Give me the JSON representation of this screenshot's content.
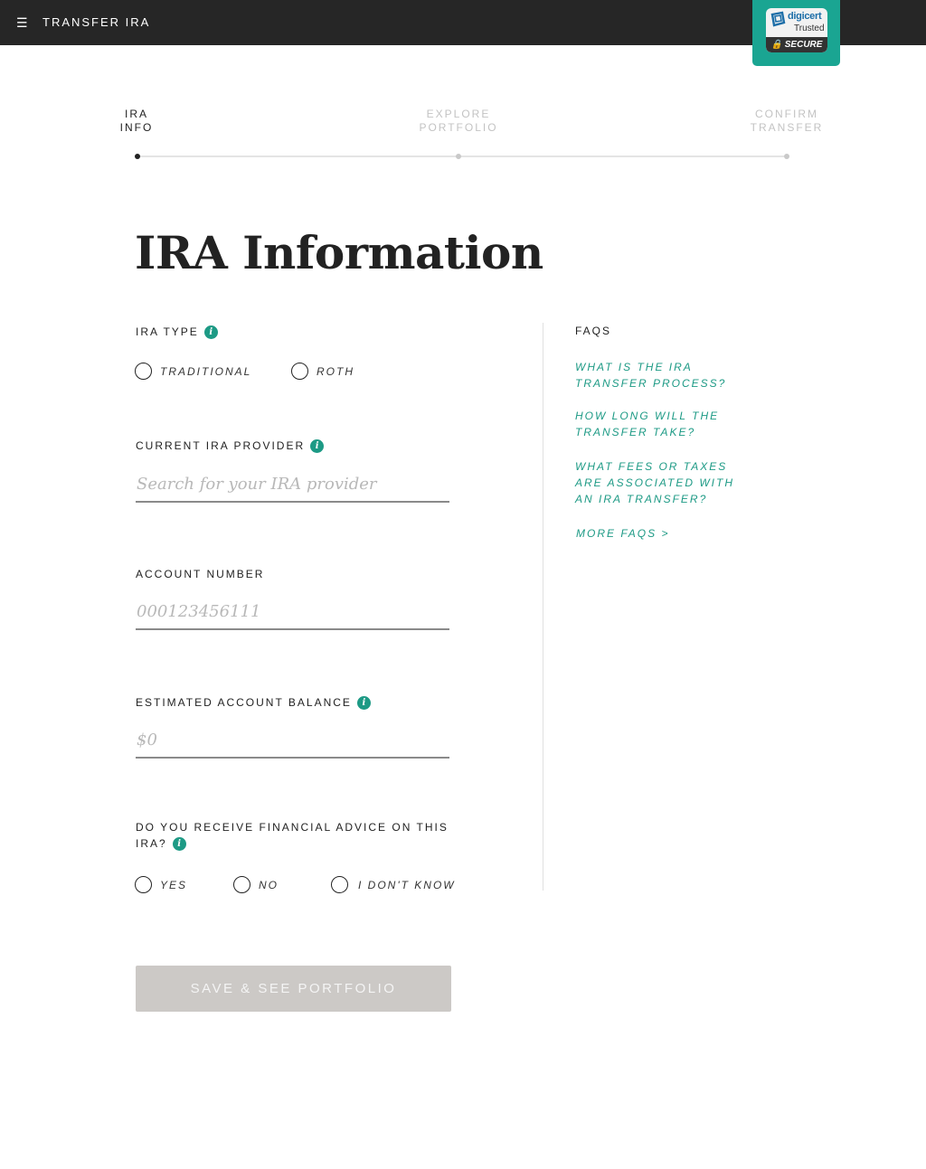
{
  "header": {
    "menu_icon": "hamburger-icon",
    "title": "TRANSFER IRA",
    "badge": {
      "brand": "digicert",
      "trusted": "Trusted",
      "secure": "SECURE"
    }
  },
  "stepper": {
    "steps": [
      {
        "line1": "IRA",
        "line2": "INFO",
        "active": true
      },
      {
        "line1": "EXPLORE",
        "line2": "PORTFOLIO",
        "active": false
      },
      {
        "line1": "CONFIRM",
        "line2": "TRANSFER",
        "active": false
      }
    ]
  },
  "page_title": "IRA Information",
  "form": {
    "ira_type": {
      "label": "IRA TYPE",
      "options": [
        "TRADITIONAL",
        "ROTH"
      ]
    },
    "provider": {
      "label": "CURRENT IRA PROVIDER",
      "placeholder": "Search for your IRA provider",
      "value": ""
    },
    "account_number": {
      "label": "ACCOUNT NUMBER",
      "placeholder": "000123456111",
      "value": ""
    },
    "balance": {
      "label": "ESTIMATED ACCOUNT BALANCE",
      "placeholder": "$0",
      "value": ""
    },
    "advice": {
      "label_line1": "DO YOU RECEIVE FINANCIAL ADVICE ON THIS",
      "label_line2": "IRA?",
      "options": [
        "YES",
        "NO",
        "I DON'T KNOW"
      ]
    },
    "submit_label": "SAVE & SEE PORTFOLIO"
  },
  "faqs": {
    "heading": "FAQS",
    "items": [
      "WHAT IS THE IRA TRANSFER PROCESS?",
      "HOW LONG WILL THE TRANSFER TAKE?",
      "WHAT FEES OR TAXES ARE ASSOCIATED WITH AN IRA TRANSFER?"
    ],
    "more": "MORE FAQS >"
  },
  "colors": {
    "accent": "#1d9a85",
    "topbar": "#262626",
    "badge": "#1aa592",
    "button_disabled": "#ccc9c6"
  }
}
